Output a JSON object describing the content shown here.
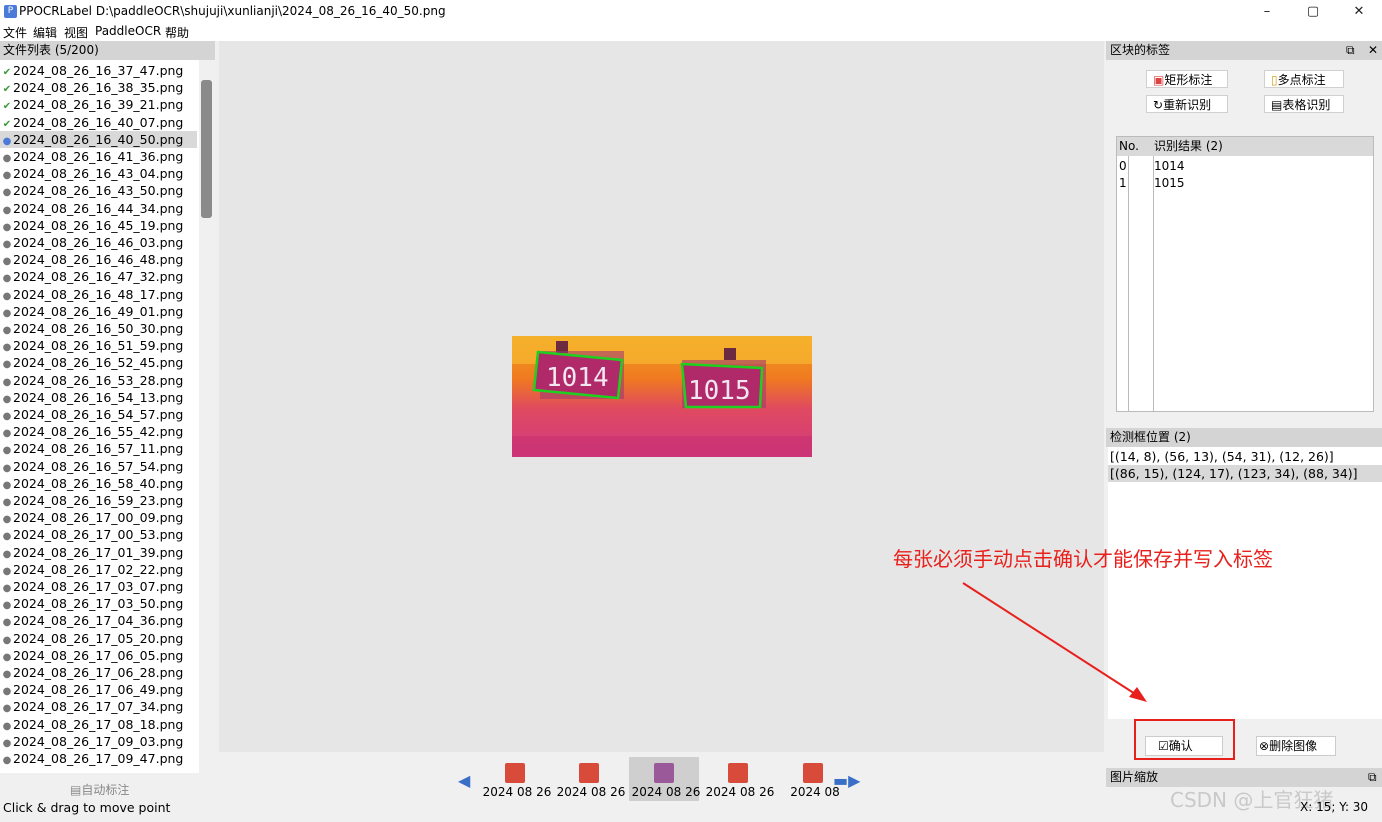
{
  "window": {
    "icon_letter": "P",
    "title": "PPOCRLabel D:\\paddleOCR\\shujuji\\xunlianji\\2024_08_26_16_40_50.png",
    "min": "–",
    "max": "▢",
    "close": "✕"
  },
  "menu": [
    "文件",
    "编辑",
    "视图",
    "PaddleOCR",
    "帮助"
  ],
  "file_panel": {
    "header": "文件列表 (5/200)",
    "auto_label": "自动标注",
    "files": [
      {
        "name": "2024_08_26_16_37_47.png",
        "state": "checked"
      },
      {
        "name": "2024_08_26_16_38_35.png",
        "state": "checked"
      },
      {
        "name": "2024_08_26_16_39_21.png",
        "state": "checked"
      },
      {
        "name": "2024_08_26_16_40_07.png",
        "state": "checked"
      },
      {
        "name": "2024_08_26_16_40_50.png",
        "state": "selected"
      },
      {
        "name": "2024_08_26_16_41_36.png",
        "state": "pending"
      },
      {
        "name": "2024_08_26_16_43_04.png",
        "state": "pending"
      },
      {
        "name": "2024_08_26_16_43_50.png",
        "state": "pending"
      },
      {
        "name": "2024_08_26_16_44_34.png",
        "state": "pending"
      },
      {
        "name": "2024_08_26_16_45_19.png",
        "state": "pending"
      },
      {
        "name": "2024_08_26_16_46_03.png",
        "state": "pending"
      },
      {
        "name": "2024_08_26_16_46_48.png",
        "state": "pending"
      },
      {
        "name": "2024_08_26_16_47_32.png",
        "state": "pending"
      },
      {
        "name": "2024_08_26_16_48_17.png",
        "state": "pending"
      },
      {
        "name": "2024_08_26_16_49_01.png",
        "state": "pending"
      },
      {
        "name": "2024_08_26_16_50_30.png",
        "state": "pending"
      },
      {
        "name": "2024_08_26_16_51_59.png",
        "state": "pending"
      },
      {
        "name": "2024_08_26_16_52_45.png",
        "state": "pending"
      },
      {
        "name": "2024_08_26_16_53_28.png",
        "state": "pending"
      },
      {
        "name": "2024_08_26_16_54_13.png",
        "state": "pending"
      },
      {
        "name": "2024_08_26_16_54_57.png",
        "state": "pending"
      },
      {
        "name": "2024_08_26_16_55_42.png",
        "state": "pending"
      },
      {
        "name": "2024_08_26_16_57_11.png",
        "state": "pending"
      },
      {
        "name": "2024_08_26_16_57_54.png",
        "state": "pending"
      },
      {
        "name": "2024_08_26_16_58_40.png",
        "state": "pending"
      },
      {
        "name": "2024_08_26_16_59_23.png",
        "state": "pending"
      },
      {
        "name": "2024_08_26_17_00_09.png",
        "state": "pending"
      },
      {
        "name": "2024_08_26_17_00_53.png",
        "state": "pending"
      },
      {
        "name": "2024_08_26_17_01_39.png",
        "state": "pending"
      },
      {
        "name": "2024_08_26_17_02_22.png",
        "state": "pending"
      },
      {
        "name": "2024_08_26_17_03_07.png",
        "state": "pending"
      },
      {
        "name": "2024_08_26_17_03_50.png",
        "state": "pending"
      },
      {
        "name": "2024_08_26_17_04_36.png",
        "state": "pending"
      },
      {
        "name": "2024_08_26_17_05_20.png",
        "state": "pending"
      },
      {
        "name": "2024_08_26_17_06_05.png",
        "state": "pending"
      },
      {
        "name": "2024_08_26_17_06_28.png",
        "state": "pending"
      },
      {
        "name": "2024_08_26_17_06_49.png",
        "state": "pending"
      },
      {
        "name": "2024_08_26_17_07_34.png",
        "state": "pending"
      },
      {
        "name": "2024_08_26_17_08_18.png",
        "state": "pending"
      },
      {
        "name": "2024_08_26_17_09_03.png",
        "state": "pending"
      },
      {
        "name": "2024_08_26_17_09_47.png",
        "state": "pending"
      }
    ]
  },
  "image": {
    "box_labels": [
      "1014",
      "1015"
    ],
    "box_color": "#1fd11f"
  },
  "thumbnails": {
    "captions": [
      "2024 08 26",
      "2024 08 26",
      "2024 08 26",
      "2024 08 26",
      "2024 08"
    ],
    "selected_index": 2
  },
  "right_panel": {
    "header": "区块的标签",
    "buttons": {
      "rect": "矩形标注",
      "poly": "多点标注",
      "recog": "重新识别",
      "table": "表格识别"
    },
    "table_headers": {
      "no": "No.",
      "result": "识别结果 (2)"
    },
    "results": [
      {
        "no": "0",
        "text": "1014"
      },
      {
        "no": "1",
        "text": "1015"
      }
    ],
    "det_header": "检测框位置 (2)",
    "det_rows": [
      "[(14, 8), (56, 13), (54, 31), (12, 26)]",
      "[(86, 15), (124, 17), (123, 34), (88, 34)]"
    ],
    "confirm": "确认",
    "delete": "删除图像",
    "zoom_header": "图片缩放"
  },
  "annotation_text": "每张必须手动点击确认才能保存并写入标签",
  "annotation_color": "#e8201c",
  "status": "Click & drag to move point",
  "coords": "X: 15; Y: 30",
  "watermark": "CSDN @上官狂猪"
}
